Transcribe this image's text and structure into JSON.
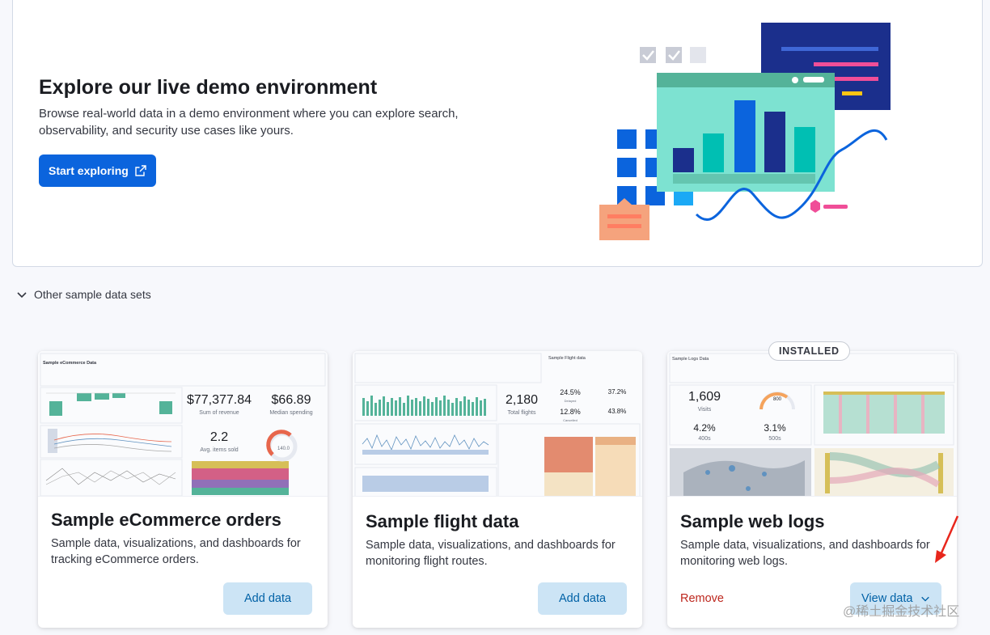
{
  "hero": {
    "title": "Explore our live demo environment",
    "description": "Browse real-world data in a demo environment where you can explore search, observability, and security use cases like yours.",
    "button_label": "Start exploring"
  },
  "section": {
    "toggle_label": "Other sample data sets"
  },
  "cards": [
    {
      "title": "Sample eCommerce orders",
      "description": "Sample data, visualizations, and dashboards for tracking eCommerce orders.",
      "action_label": "Add data",
      "thumb": {
        "header": "Sample eCommerce Data",
        "kpis": [
          {
            "value": "$77,377.84",
            "label": "Sum of revenue"
          },
          {
            "value": "$66.89",
            "label": "Median spending"
          },
          {
            "value": "2.2",
            "label": "Avg. items sold"
          }
        ],
        "gauge_value": "140.0"
      }
    },
    {
      "title": "Sample flight data",
      "description": "Sample data, visualizations, and dashboards for monitoring flight routes.",
      "action_label": "Add data",
      "thumb": {
        "header": "Sample Flight data",
        "kpis": [
          {
            "value": "2,180",
            "label": "Total flights"
          },
          {
            "value": "24.5%",
            "label": "Delayed"
          },
          {
            "value": "37.2%",
            "label": ""
          },
          {
            "value": "12.8%",
            "label": "Cancelled"
          },
          {
            "value": "43.8%",
            "label": ""
          }
        ]
      }
    },
    {
      "title": "Sample web logs",
      "description": "Sample data, visualizations, and dashboards for monitoring web logs.",
      "remove_label": "Remove",
      "action_label": "View data",
      "badge": "INSTALLED",
      "thumb": {
        "header": "Sample Logs Data",
        "kpis": [
          {
            "value": "1,609",
            "label": "Visits"
          },
          {
            "value": "800",
            "label": ""
          },
          {
            "value": "4.2%",
            "label": "400s"
          },
          {
            "value": "3.1%",
            "label": "500s"
          }
        ]
      }
    }
  ],
  "watermark": "@稀土掘金技术社区",
  "colors": {
    "primary": "#0b64dd",
    "secondary_bg": "#cce4f5",
    "danger": "#bd271e"
  }
}
